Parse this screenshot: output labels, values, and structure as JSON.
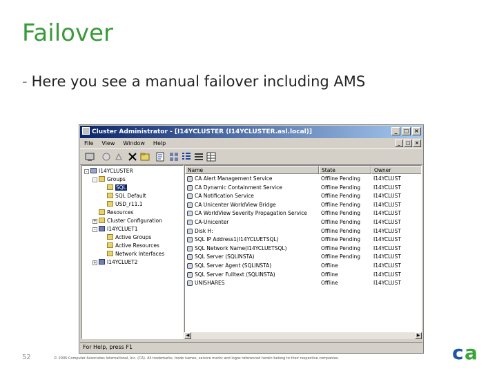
{
  "slide": {
    "title": "Failover",
    "bullet": "Here you see a manual failover including AMS",
    "page_number": "52",
    "copyright": "© 2005 Computer Associates International, Inc. (CA). All trademarks, trade names, service marks and logos referenced herein belong to their respective companies.",
    "logo_text": "ca"
  },
  "window": {
    "title": "Cluster Administrator - [I14YCLUSTER (I14YCLUSTER.asl.local)]",
    "menus": [
      "File",
      "View",
      "Window",
      "Help"
    ],
    "status": "For Help, press F1"
  },
  "tree": [
    {
      "label": "I14YCLUSTER",
      "kind": "cluster",
      "expander": "-"
    },
    {
      "label": "Groups",
      "kind": "folder",
      "expander": "-"
    },
    {
      "label": "SQL",
      "kind": "folder",
      "selected": true
    },
    {
      "label": "SQL Default",
      "kind": "folder"
    },
    {
      "label": "USD_r11.1",
      "kind": "folder"
    },
    {
      "label": "Resources",
      "kind": "folder"
    },
    {
      "label": "Cluster Configuration",
      "kind": "folder",
      "expander": "+"
    },
    {
      "label": "I14YCLUET1",
      "kind": "server",
      "expander": "-"
    },
    {
      "label": "Active Groups",
      "kind": "folder"
    },
    {
      "label": "Active Resources",
      "kind": "folder"
    },
    {
      "label": "Network Interfaces",
      "kind": "folder"
    },
    {
      "label": "I14YCLUET2",
      "kind": "server",
      "expander": "+"
    }
  ],
  "list": {
    "columns": {
      "name": "Name",
      "state": "State",
      "owner": "Owner"
    },
    "rows": [
      {
        "name": "CA Alert Management Service",
        "state": "Offline Pending",
        "owner": "I14YCLUST"
      },
      {
        "name": "CA Dynamic Containment Service",
        "state": "Offline Pending",
        "owner": "I14YCLUST"
      },
      {
        "name": "CA Notification Service",
        "state": "Offline Pending",
        "owner": "I14YCLUST"
      },
      {
        "name": "CA Unicenter WorldView Bridge",
        "state": "Offline Pending",
        "owner": "I14YCLUST"
      },
      {
        "name": "CA WorldView Severity Propagation Service",
        "state": "Offline Pending",
        "owner": "I14YCLUST"
      },
      {
        "name": "CA-Unicenter",
        "state": "Offline Pending",
        "owner": "I14YCLUST"
      },
      {
        "name": "Disk H:",
        "state": "Offline Pending",
        "owner": "I14YCLUST"
      },
      {
        "name": "SQL IP Address1(I14YCLUETSQL)",
        "state": "Offline Pending",
        "owner": "I14YCLUST"
      },
      {
        "name": "SQL Network Name(I14YCLUETSQL)",
        "state": "Offline Pending",
        "owner": "I14YCLUST"
      },
      {
        "name": "SQL Server (SQLINSTA)",
        "state": "Offline Pending",
        "owner": "I14YCLUST"
      },
      {
        "name": "SQL Server Agent (SQLINSTA)",
        "state": "Offline",
        "owner": "I14YCLUST"
      },
      {
        "name": "SQL Server Fulltext (SQLINSTA)",
        "state": "Offline",
        "owner": "I14YCLUST"
      },
      {
        "name": "UNISHARES",
        "state": "Offline",
        "owner": "I14YCLUST"
      }
    ]
  },
  "colors": {
    "title_green": "#3a9a3a",
    "titlebar": "#0a246a",
    "logo_blue": "#1f56a8",
    "logo_green": "#3aa53a"
  }
}
